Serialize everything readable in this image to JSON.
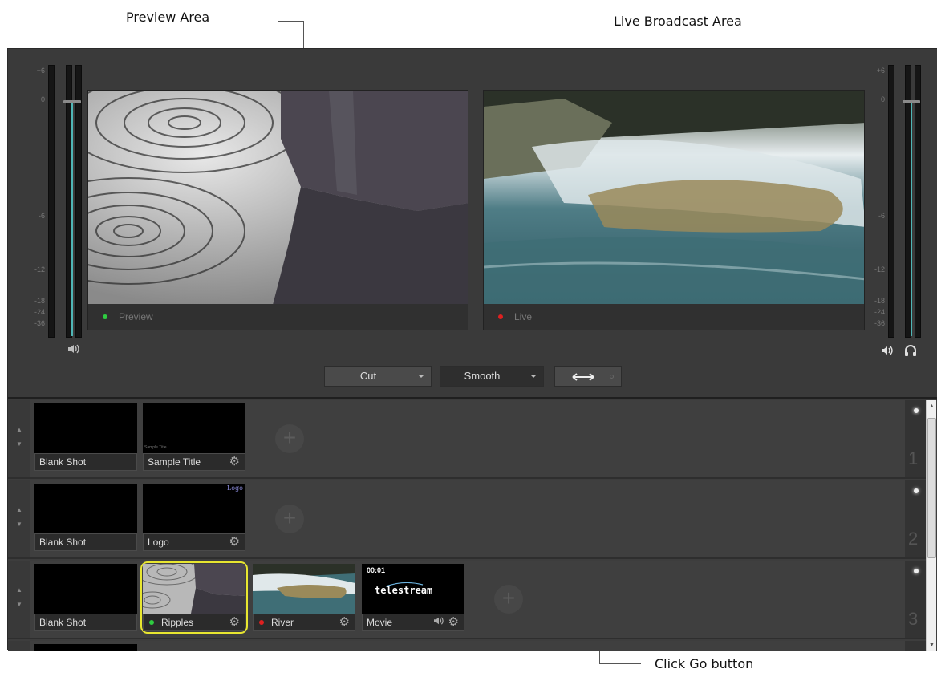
{
  "callouts": {
    "preview_area": "Preview Area",
    "live_area": "Live Broadcast Area",
    "go_button": "Click Go button"
  },
  "meters": {
    "scale_labels": [
      "+6",
      "0",
      "-6",
      "-12",
      "-18",
      "-24",
      "-36"
    ],
    "left_icon": "speaker-icon",
    "right_icons": [
      "speaker-icon",
      "headphones-icon"
    ]
  },
  "preview": {
    "label": "Preview",
    "status_color": "#2ecc40"
  },
  "live": {
    "label": "Live",
    "status_color": "#e02020"
  },
  "transitions": {
    "cut": "Cut",
    "smooth": "Smooth",
    "go_icon": "swap-arrows-icon"
  },
  "layers": [
    {
      "number": "1",
      "shots": [
        {
          "label": "Blank Shot"
        },
        {
          "label": "Sample Title",
          "thumb_text": "Sample Title"
        }
      ]
    },
    {
      "number": "2",
      "shots": [
        {
          "label": "Blank Shot"
        },
        {
          "label": "Logo",
          "thumb_text": "Logo"
        }
      ]
    },
    {
      "number": "3",
      "shots": [
        {
          "label": "Blank Shot"
        },
        {
          "label": "Ripples",
          "status_color": "#2ecc40",
          "selected": true
        },
        {
          "label": "River",
          "status_color": "#e02020"
        },
        {
          "label": "Movie",
          "timecode": "00:01",
          "logo": "telestream"
        }
      ]
    }
  ]
}
